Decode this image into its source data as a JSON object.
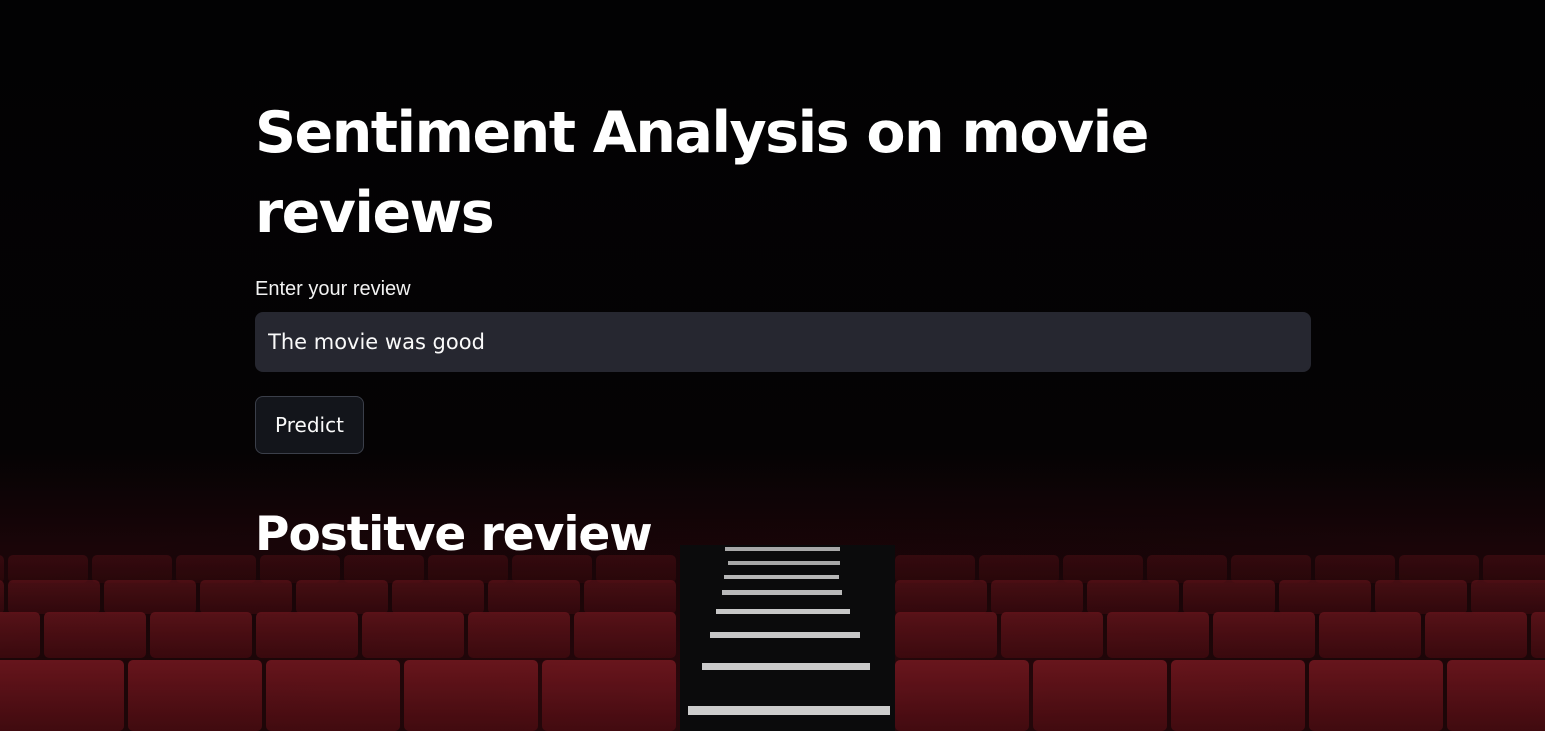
{
  "page": {
    "title": "Sentiment Analysis on movie reviews"
  },
  "form": {
    "label": "Enter your review",
    "input_value": "The movie was good",
    "predict_label": "Predict"
  },
  "result": {
    "text": "Postitve review"
  },
  "colors": {
    "background": "#020203",
    "input_bg": "#262730",
    "button_bg": "#13151b",
    "seat_red": "#6e141c",
    "text": "#fafafa"
  }
}
